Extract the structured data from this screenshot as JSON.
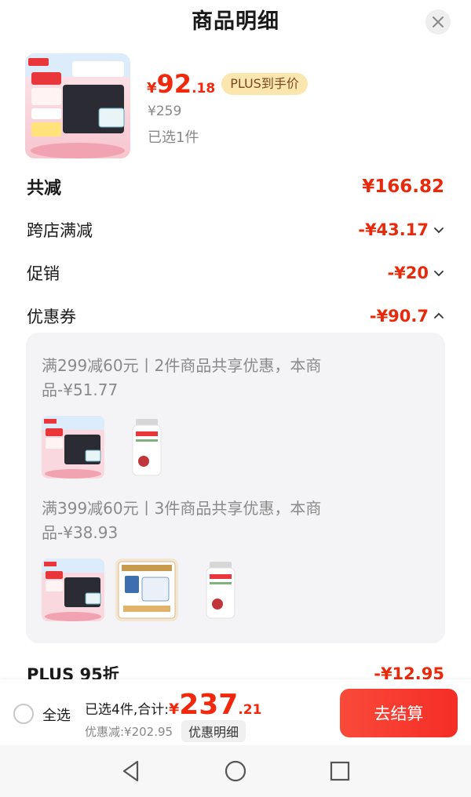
{
  "header": {
    "title": "商品明细"
  },
  "product": {
    "price_currency": "¥",
    "price_int": "92",
    "price_dec": ".18",
    "plus_badge": "PLUS到手价",
    "original_price": "¥259",
    "selected_count": "已选1件"
  },
  "breakdown": {
    "total": {
      "label": "共减",
      "value": "¥166.82"
    },
    "cross_store": {
      "label": "跨店满减",
      "value": "-¥43.17"
    },
    "promotion": {
      "label": "促销",
      "value": "-¥20"
    },
    "coupon": {
      "label": "优惠券",
      "value": "-¥90.7"
    },
    "plus_discount": {
      "label": "PLUS 95折",
      "value": "-¥12.95"
    }
  },
  "coupons": [
    {
      "line1": "满299减60元丨2件商品共享优惠，本商",
      "line2": "品-¥51.77"
    },
    {
      "line1": "满399减60元丨3件商品共享优惠，本商",
      "line2": "品-¥38.93"
    }
  ],
  "checkout": {
    "select_all": "全选",
    "sum_label": "已选4件,合计:",
    "sum_currency": "¥",
    "sum_int": "237",
    "sum_dec": ".21",
    "discount": "优惠减:¥202.95",
    "detail_button": "优惠明细",
    "checkout_button": "去结算"
  },
  "colors": {
    "accent": "#f2270c",
    "plus_badge_bg": "#fbe7ae",
    "checkout_button": "#f94a3a"
  },
  "icons": [
    "close-icon",
    "chevron-down-icon",
    "chevron-up-icon",
    "nav-back-icon",
    "nav-home-icon",
    "nav-recents-icon"
  ]
}
